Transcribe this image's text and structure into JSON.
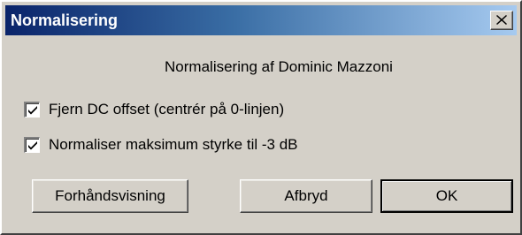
{
  "window": {
    "title": "Normalisering",
    "close_glyph": "✕",
    "titlebar_colors": [
      "#0a246a",
      "#a6caf0"
    ]
  },
  "heading": "Normalisering af Dominic Mazzoni",
  "options": [
    {
      "label": "Fjern DC offset (centrér på 0-linjen)",
      "checked": true
    },
    {
      "label": "Normaliser maksimum styrke til -3 dB",
      "checked": true
    }
  ],
  "buttons": {
    "preview": "Forhåndsvisning",
    "cancel": "Afbryd",
    "ok": "OK"
  }
}
